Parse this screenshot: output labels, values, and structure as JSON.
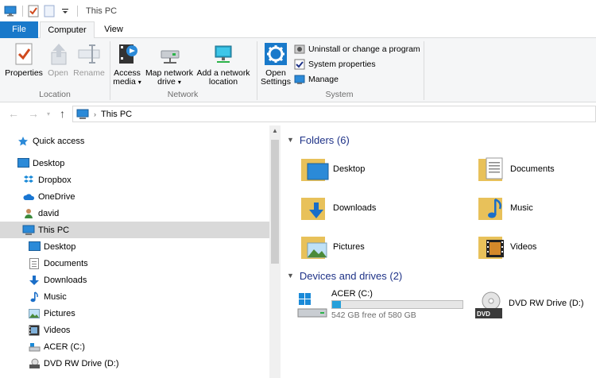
{
  "window": {
    "title": "This PC"
  },
  "tabs": {
    "file": "File",
    "computer": "Computer",
    "view": "View"
  },
  "ribbon": {
    "location": {
      "label": "Location",
      "properties": "Properties",
      "open": "Open",
      "rename": "Rename"
    },
    "network": {
      "label": "Network",
      "access_media": "Access\nmedia",
      "map_network_drive": "Map network\ndrive",
      "add_network_location": "Add a network\nlocation"
    },
    "system": {
      "label": "System",
      "open_settings": "Open\nSettings",
      "uninstall": "Uninstall or change a program",
      "system_properties": "System properties",
      "manage": "Manage"
    }
  },
  "address": {
    "path": "This PC"
  },
  "nav": {
    "items": [
      {
        "label": "Quick access",
        "icon": "star-icon"
      },
      {
        "label": "Desktop",
        "icon": "desktop-icon"
      },
      {
        "label": "Dropbox",
        "icon": "dropbox-icon"
      },
      {
        "label": "OneDrive",
        "icon": "onedrive-icon"
      },
      {
        "label": "david",
        "icon": "user-icon"
      },
      {
        "label": "This PC",
        "icon": "computer-icon"
      },
      {
        "label": "Desktop",
        "icon": "desktop-icon"
      },
      {
        "label": "Documents",
        "icon": "documents-icon"
      },
      {
        "label": "Downloads",
        "icon": "downloads-icon"
      },
      {
        "label": "Music",
        "icon": "music-icon"
      },
      {
        "label": "Pictures",
        "icon": "pictures-icon"
      },
      {
        "label": "Videos",
        "icon": "videos-icon"
      },
      {
        "label": "ACER (C:)",
        "icon": "drive-icon"
      },
      {
        "label": "DVD RW Drive (D:)",
        "icon": "dvd-icon"
      }
    ]
  },
  "content": {
    "folders_header": "Folders (6)",
    "folders": [
      {
        "label": "Desktop"
      },
      {
        "label": "Documents"
      },
      {
        "label": "Downloads"
      },
      {
        "label": "Music"
      },
      {
        "label": "Pictures"
      },
      {
        "label": "Videos"
      }
    ],
    "devices_header": "Devices and drives (2)",
    "drives": [
      {
        "label": "ACER (C:)",
        "free": "542 GB free of 580 GB",
        "used_fraction": 0.066
      },
      {
        "label": "DVD RW Drive (D:)",
        "dvd_text": "DVD"
      }
    ]
  },
  "colors": {
    "accent": "#1979ca",
    "header_text": "#1e3287",
    "selection": "#d9d9d9",
    "drive_fill": "#26a0da"
  }
}
